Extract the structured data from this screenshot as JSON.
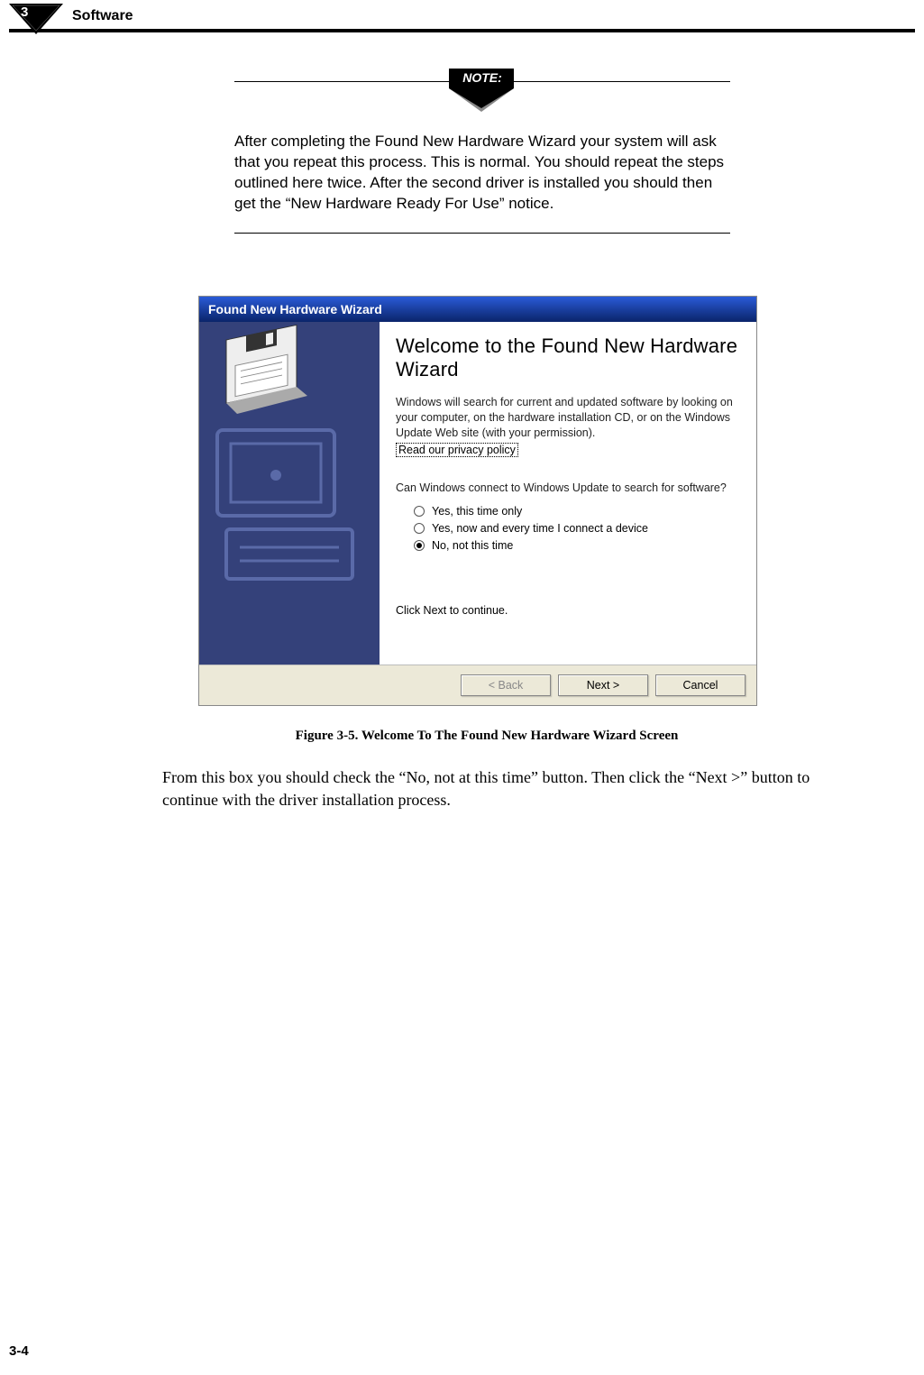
{
  "header": {
    "chapter_number": "3",
    "section": "Software"
  },
  "note": {
    "label": "NOTE:",
    "text": "After completing the Found New Hardware Wizard your system will ask that you repeat this process. This is normal. You should repeat the steps outlined here twice. After the second driver is installed you should then get the “New Hardware Ready For Use” notice."
  },
  "dialog": {
    "title": "Found New Hardware Wizard",
    "heading": "Welcome to the Found New Hardware Wizard",
    "intro": "Windows will search for current and updated software by looking on your computer, on the hardware installation CD, or on the Windows Update Web site (with your permission).",
    "privacy_link": "Read our privacy policy",
    "question": "Can Windows connect to Windows Update to search for software?",
    "options": [
      {
        "label": "Yes, this time only",
        "checked": false
      },
      {
        "label": "Yes, now and every time I connect a device",
        "checked": false
      },
      {
        "label": "No, not this time",
        "checked": true
      }
    ],
    "continue": "Click Next to continue.",
    "buttons": {
      "back": "< Back",
      "next": "Next >",
      "cancel": "Cancel"
    }
  },
  "figure_caption": "Figure 3-5.  Welcome To The Found New Hardware Wizard Screen",
  "body": "From this box you should check the “No, not at this time” button. Then click the “Next >” button to continue with the driver installation process.",
  "page_number": "3-4"
}
